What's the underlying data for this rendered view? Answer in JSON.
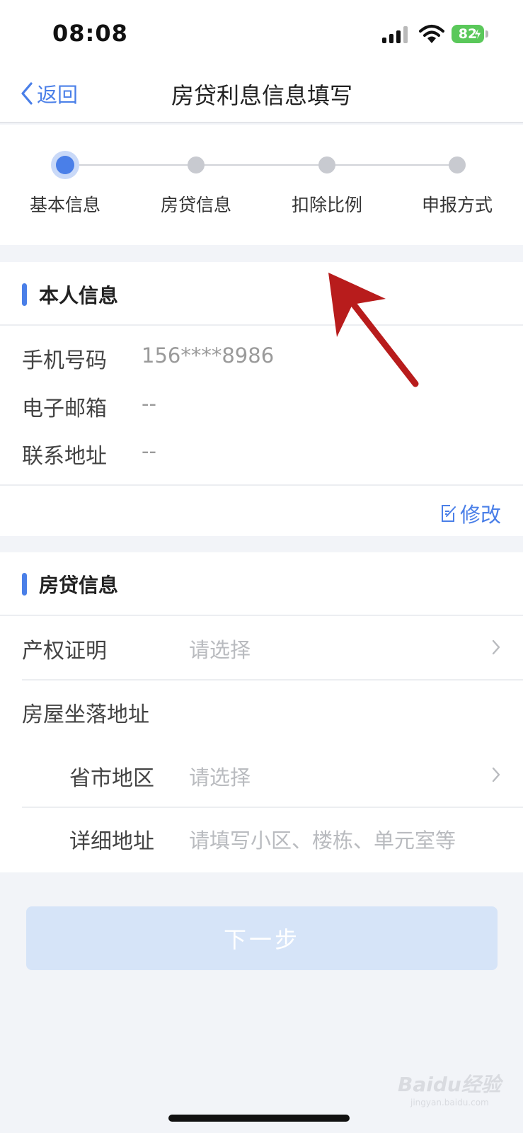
{
  "status_bar": {
    "time": "08:08",
    "battery": "82"
  },
  "nav": {
    "back_label": "返回",
    "title": "房贷利息信息填写"
  },
  "steps": {
    "items": [
      {
        "label": "基本信息",
        "active": true
      },
      {
        "label": "房贷信息",
        "active": false
      },
      {
        "label": "扣除比例",
        "active": false
      },
      {
        "label": "申报方式",
        "active": false
      }
    ]
  },
  "personal": {
    "title": "本人信息",
    "rows": [
      {
        "label": "手机号码",
        "value": "156****8986"
      },
      {
        "label": "电子邮箱",
        "value": "--"
      },
      {
        "label": "联系地址",
        "value": "--"
      }
    ],
    "edit_label": "修改"
  },
  "mortgage": {
    "title": "房贷信息",
    "ownership_label": "产权证明",
    "ownership_placeholder": "请选择",
    "address_label": "房屋坐落地址",
    "region_label": "省市地区",
    "region_placeholder": "请选择",
    "detail_label": "详细地址",
    "detail_placeholder": "请填写小区、楼栋、单元室等"
  },
  "footer": {
    "next_label": "下一步"
  },
  "watermark": {
    "text": "Baidu经验",
    "sub": "jingyan.baidu.com"
  },
  "colors": {
    "accent": "#4a7fe8",
    "annotation_arrow": "#b81c1c",
    "background": "#f2f4f8"
  }
}
